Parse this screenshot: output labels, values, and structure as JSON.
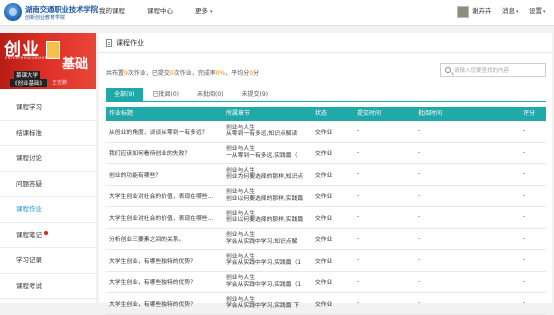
{
  "header": {
    "logo_name": "湖南交通职业技术学院",
    "logo_sub": "创新创业教育学院",
    "nav": [
      {
        "label": "我的课程"
      },
      {
        "label": "课程中心"
      },
      {
        "label": "更多",
        "caret": "▾"
      }
    ],
    "user_name": "谢卉卉",
    "messages_label": "消息",
    "settings_label": "设置"
  },
  "banner": {
    "title1": "创业",
    "english": "ENTREPRENEURSHIP",
    "title2": "基础",
    "tag1": "慕课大学",
    "tag2": "《创业基础》",
    "author": "王吉鹏"
  },
  "sidebar": {
    "items": [
      {
        "label": "课程学习"
      },
      {
        "label": "结课标准"
      },
      {
        "label": "课程讨论"
      },
      {
        "label": "问题答疑"
      },
      {
        "label": "课程作业",
        "active": true
      },
      {
        "label": "课程笔记",
        "dot": true
      },
      {
        "label": "学习记录"
      },
      {
        "label": "课程考试"
      }
    ]
  },
  "main": {
    "title": "课程作业",
    "summary": {
      "prefix": "共布置",
      "total": "9",
      "mid1": "次作业，已提交",
      "submitted": "0",
      "mid2": "次作业，完成率",
      "rate": "0%",
      "mid3": "，平均分",
      "avg": "0",
      "suffix": "分"
    },
    "search_placeholder": "请输入您要查找的内容",
    "tabs": [
      {
        "label": "全部(9)",
        "active": true
      },
      {
        "label": "已批阅(0)"
      },
      {
        "label": "未批阅(0)"
      },
      {
        "label": "未提交(9)"
      }
    ],
    "columns": [
      "作业标题",
      "所属章节",
      "状态",
      "提交时间",
      "批阅时间",
      "评分"
    ],
    "rows": [
      {
        "title": "从创业的角度，谈谈从零到一有多远？",
        "chapter1": "创业与人生",
        "chapter2": "从零到一有多远,知识点解读",
        "status": "交作业",
        "submit": "-",
        "review": "-",
        "score": "-"
      },
      {
        "title": "我们应该如何看待创业的失败？",
        "chapter1": "创业与人生",
        "chapter2": "一从零到一有多远,实践篇（",
        "status": "交作业",
        "submit": "-",
        "review": "-",
        "score": "-"
      },
      {
        "title": "创业的功能有哪些？",
        "chapter1": "创业与人生",
        "chapter2": "创业为何要选择的那样,知识点",
        "status": "交作业",
        "submit": "-",
        "review": "-",
        "score": "-"
      },
      {
        "title": "大学生创业对社会的价值，表现在哪些...",
        "chapter1": "创业与人生",
        "chapter2": "创业以何要选择的那样,实践篇",
        "status": "交作业",
        "submit": "-",
        "review": "-",
        "score": "-"
      },
      {
        "title": "大学生创业对社会的价值，表现在哪些...",
        "chapter1": "创业与人生",
        "chapter2": "创业以何要选择的那样,实践篇",
        "status": "交作业",
        "submit": "-",
        "review": "-",
        "score": "-"
      },
      {
        "title": "分析创业三要素之间的关系。",
        "chapter1": "创业与人生",
        "chapter2": "学会从实践中学习,知识点解",
        "status": "交作业",
        "submit": "-",
        "review": "-",
        "score": "-"
      },
      {
        "title": "大学生创业，有哪些独特的优势？",
        "chapter1": "创业与人生",
        "chapter2": "学会从实践中学习,实践篇（1",
        "status": "交作业",
        "submit": "-",
        "review": "-",
        "score": "-"
      },
      {
        "title": "大学生创业，有哪些独特的优势？",
        "chapter1": "创业与人生",
        "chapter2": "学会从实践中学习,实践篇（1",
        "status": "交作业",
        "submit": "-",
        "review": "-",
        "score": "-"
      },
      {
        "title": "大学生创业，有哪些独特的优势？",
        "chapter1": "创业与人生",
        "chapter2": "学会从实践中学习,实践篇 下",
        "status": "交作业",
        "submit": "-",
        "review": "-",
        "score": "-"
      }
    ]
  },
  "colors": {
    "accent": "#21a8a8",
    "banner_red": "#d92b22",
    "highlight_orange": "#ff8a00",
    "active_link": "#1f8fd0"
  }
}
